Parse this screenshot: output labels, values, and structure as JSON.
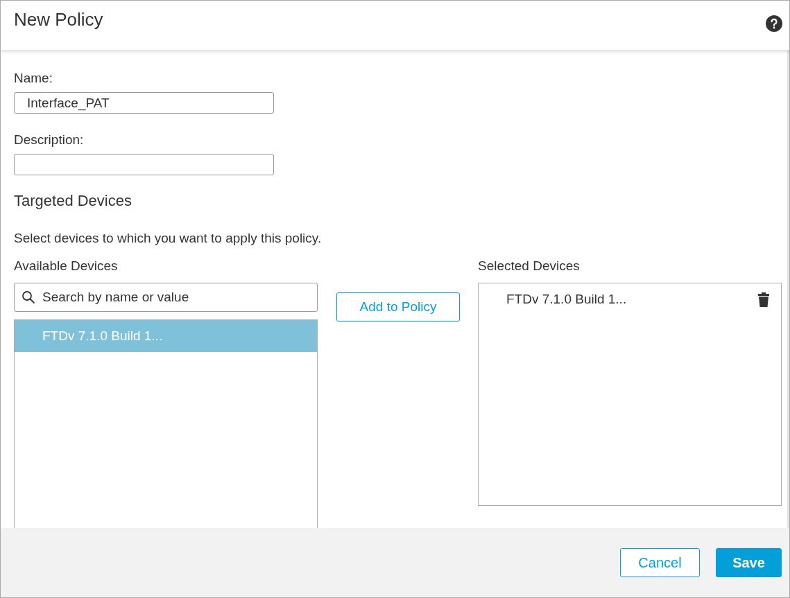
{
  "dialog": {
    "title": "New Policy"
  },
  "form": {
    "name": {
      "label": "Name:",
      "value": "Interface_PAT"
    },
    "description": {
      "label": "Description:"
    }
  },
  "targeted_devices": {
    "heading": "Targeted Devices",
    "instruction": "Select devices to which you want to apply this policy.",
    "available": {
      "label": "Available Devices",
      "search": {
        "placeholder": "Search by name or value"
      },
      "items": [
        {
          "name": "FTDv 7.1.0 Build 1...",
          "selected": true
        }
      ]
    },
    "add_button": "Add to Policy",
    "selected_devices": {
      "label": "Selected Devices",
      "items": [
        {
          "name": "FTDv 7.1.0 Build 1..."
        }
      ]
    }
  },
  "buttons": [
    {
      "label": "Cancel",
      "kind": "secondary"
    },
    {
      "label": "Save",
      "kind": "primary"
    }
  ]
}
